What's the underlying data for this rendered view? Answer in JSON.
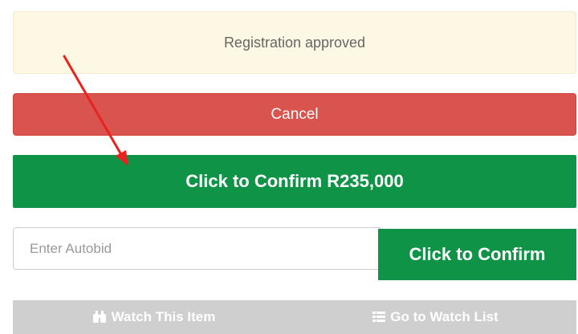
{
  "status": {
    "text": "Registration approved"
  },
  "cancel": {
    "label": "Cancel"
  },
  "confirm_main": {
    "label": "Click to Confirm R235,000"
  },
  "autobid": {
    "placeholder": "Enter Autobid",
    "value": "",
    "confirm_label": "Click to Confirm"
  },
  "watch": {
    "watch_item_label": "Watch This Item",
    "watch_item_icon": "binoculars-icon",
    "watch_list_label": "Go to Watch List",
    "watch_list_icon": "list-icon"
  },
  "annotation": {
    "type": "arrow",
    "color": "#e8231f"
  },
  "colors": {
    "success": "#0f9347",
    "danger": "#d9534f",
    "warning_bg": "#fcf8e3",
    "disabled": "#cfcfcf"
  }
}
